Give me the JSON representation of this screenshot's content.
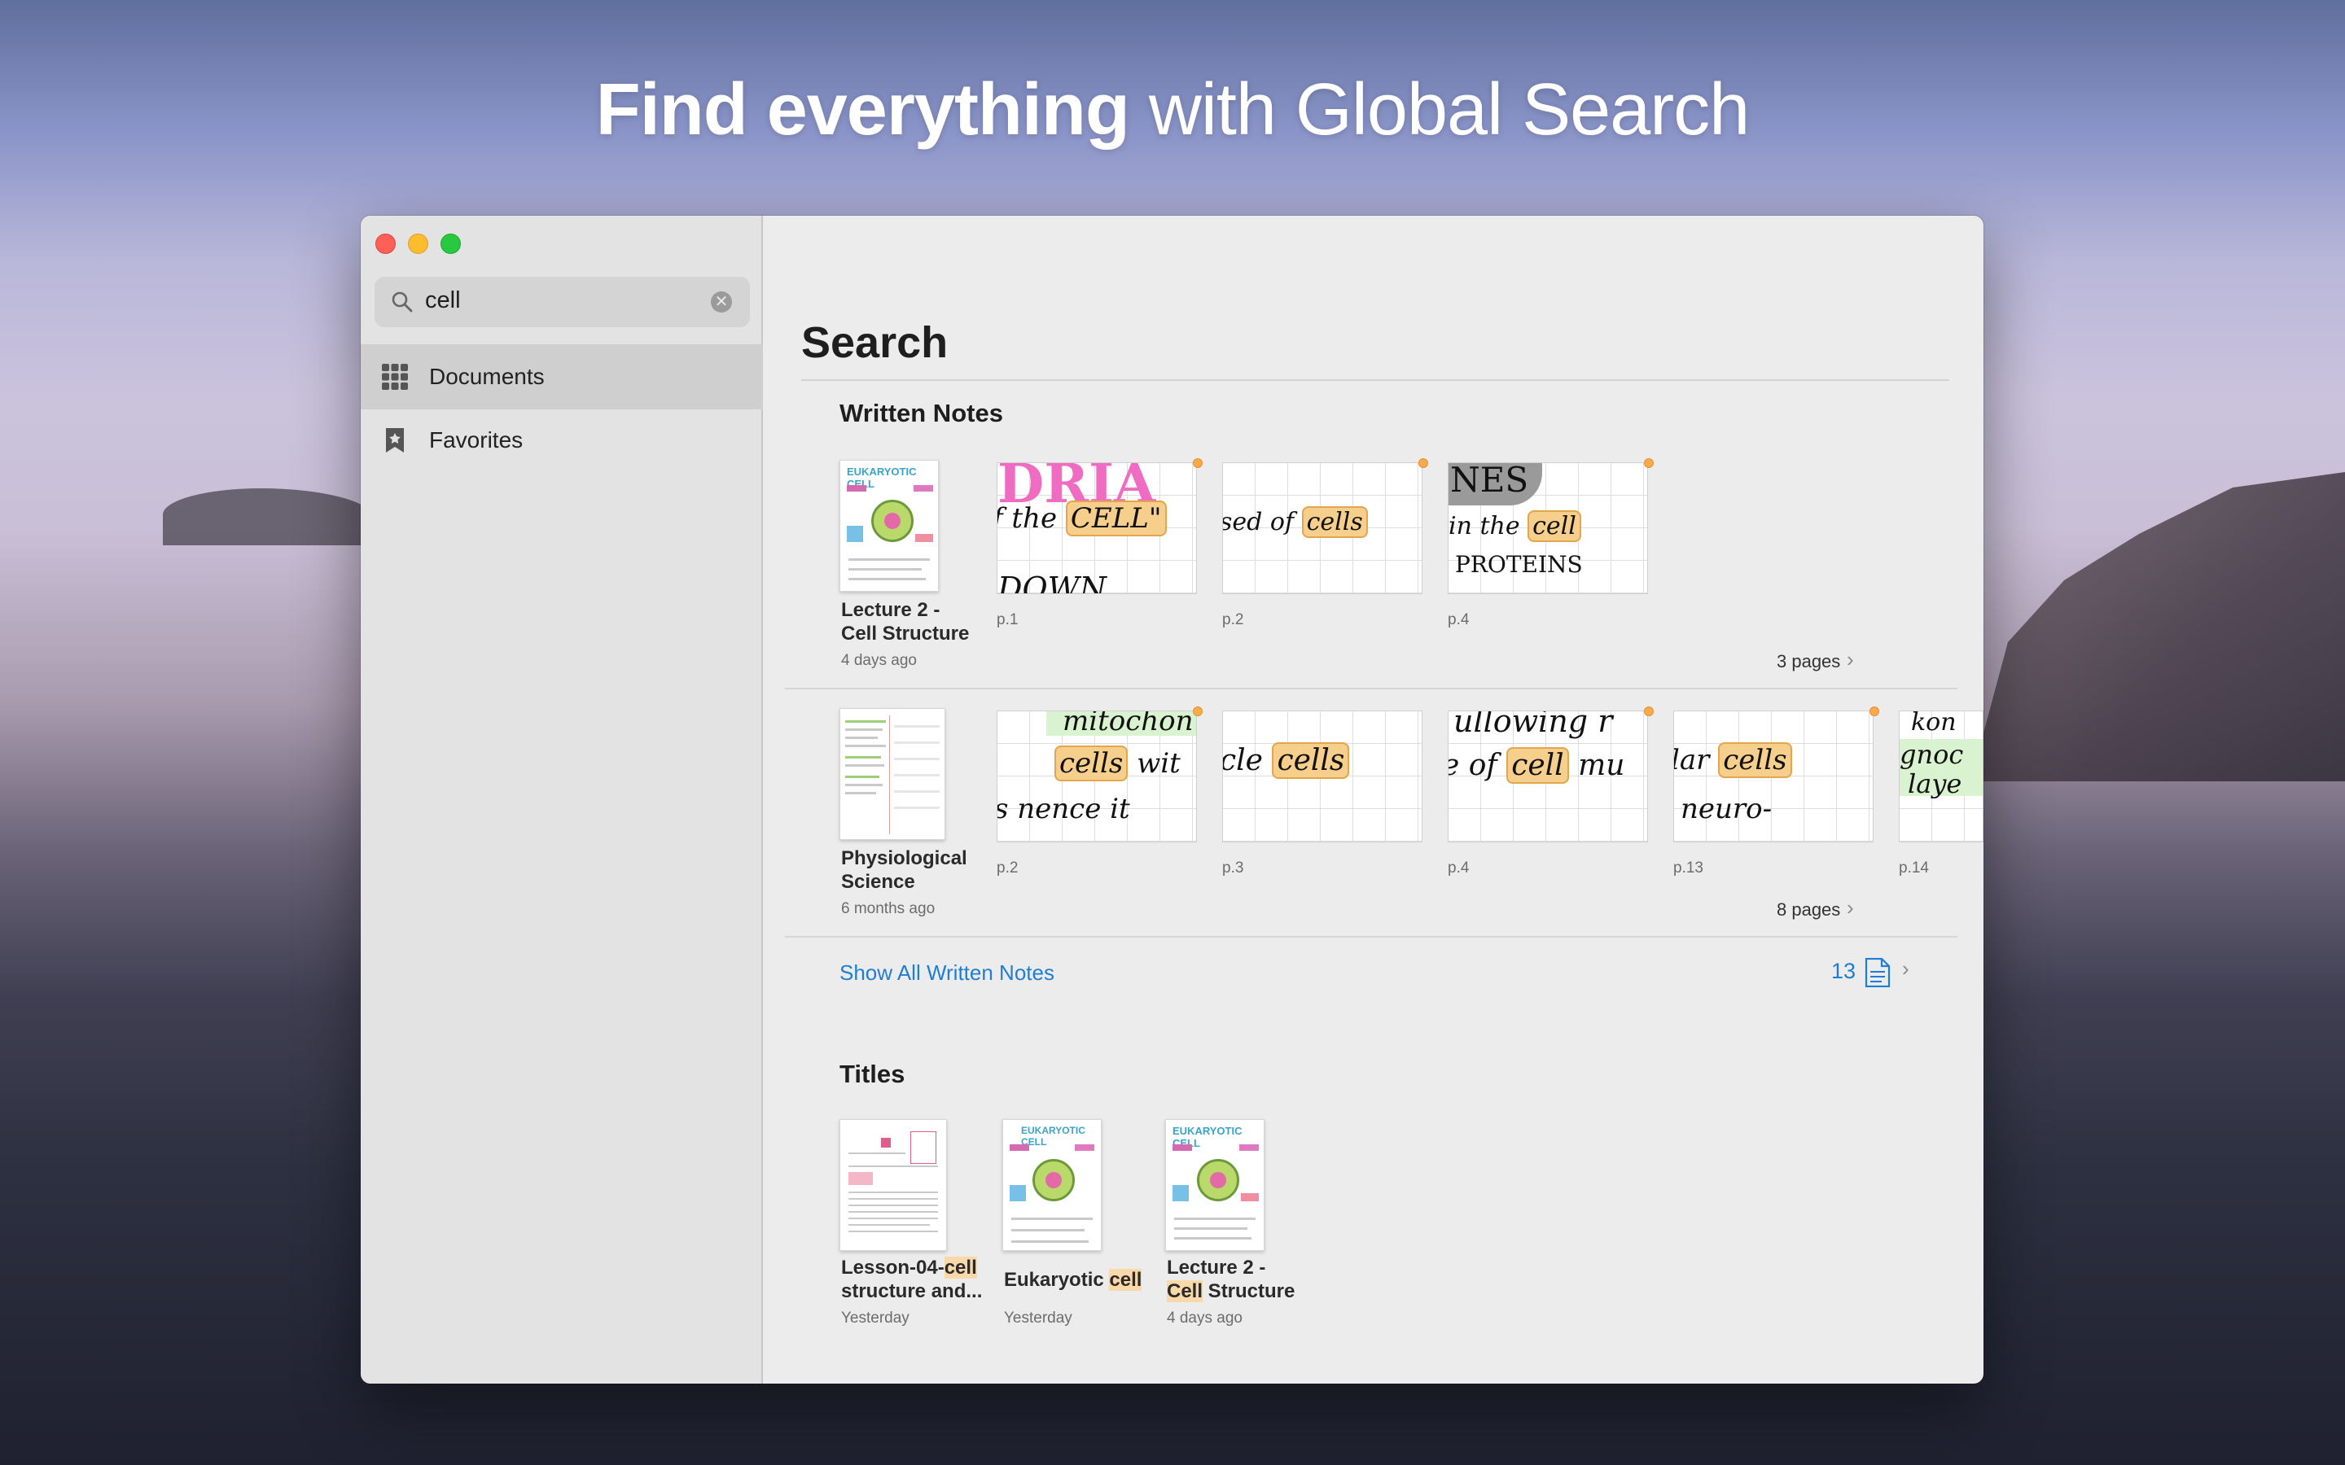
{
  "headline": {
    "bold": "Find everything",
    "rest": " with Global Search"
  },
  "sidebar": {
    "search": {
      "value": "cell",
      "icon": "magnifier-icon",
      "clear_icon": "clear-icon"
    },
    "items": [
      {
        "label": "Documents",
        "icon": "grid-icon",
        "selected": true
      },
      {
        "label": "Favorites",
        "icon": "bookmark-star-icon",
        "selected": false
      }
    ]
  },
  "main": {
    "title": "Search",
    "written_notes": {
      "heading": "Written Notes",
      "results": [
        {
          "name_line1": "Lecture 2 -",
          "name_line2": "Cell Structure",
          "date": "4 days ago",
          "pages_count": "3 pages",
          "pages": [
            {
              "label": "p.1",
              "line1": "DRIA",
              "line2_pre": "f the ",
              "line2_hl": "CELL\"",
              "line3": "DOWN"
            },
            {
              "label": "p.2",
              "line2_pre": "sed of ",
              "line2_hl": "cells"
            },
            {
              "label": "p.4",
              "line1": "NES",
              "line2_pre": "in the ",
              "line2_hl": "cell",
              "line3": "PROTEINS"
            }
          ]
        },
        {
          "name_line1": "Physiological",
          "name_line2": "Science",
          "date": "6 months ago",
          "pages_count": "8 pages",
          "pages": [
            {
              "label": "p.2",
              "line1": "mitochon",
              "line2_pre": "",
              "line2_hl": "cells",
              "line2_post": " wit",
              "line3": "s nence it"
            },
            {
              "label": "p.3",
              "line2_pre": "cle ",
              "line2_hl": "cells"
            },
            {
              "label": "p.4",
              "line1": "ullowing r",
              "line2_pre": "e of ",
              "line2_hl": "cell",
              "line2_post": " mu"
            },
            {
              "label": "p.13",
              "line2_pre": "lar ",
              "line2_hl": "cells",
              "line3": "neuro-"
            },
            {
              "label": "p.14",
              "line1": "kon",
              "line2_pre": "gnoc",
              "line3": "laye"
            }
          ]
        }
      ],
      "show_all": "Show All Written Notes",
      "total": "13",
      "total_icon": "document-icon"
    },
    "titles": {
      "heading": "Titles",
      "results": [
        {
          "pre1": "Lesson-04-",
          "hl1": "cell",
          "post1": "",
          "line2": "structure and...",
          "date": "Yesterday"
        },
        {
          "pre1": "Eukaryotic ",
          "hl1": "cell",
          "post1": "",
          "line2": "",
          "date": "Yesterday"
        },
        {
          "pre1": "Lecture 2 -",
          "hl1": "",
          "post1": "",
          "line2_hl": "Cell",
          "line2": " Structure",
          "date": "4 days ago"
        }
      ]
    }
  }
}
